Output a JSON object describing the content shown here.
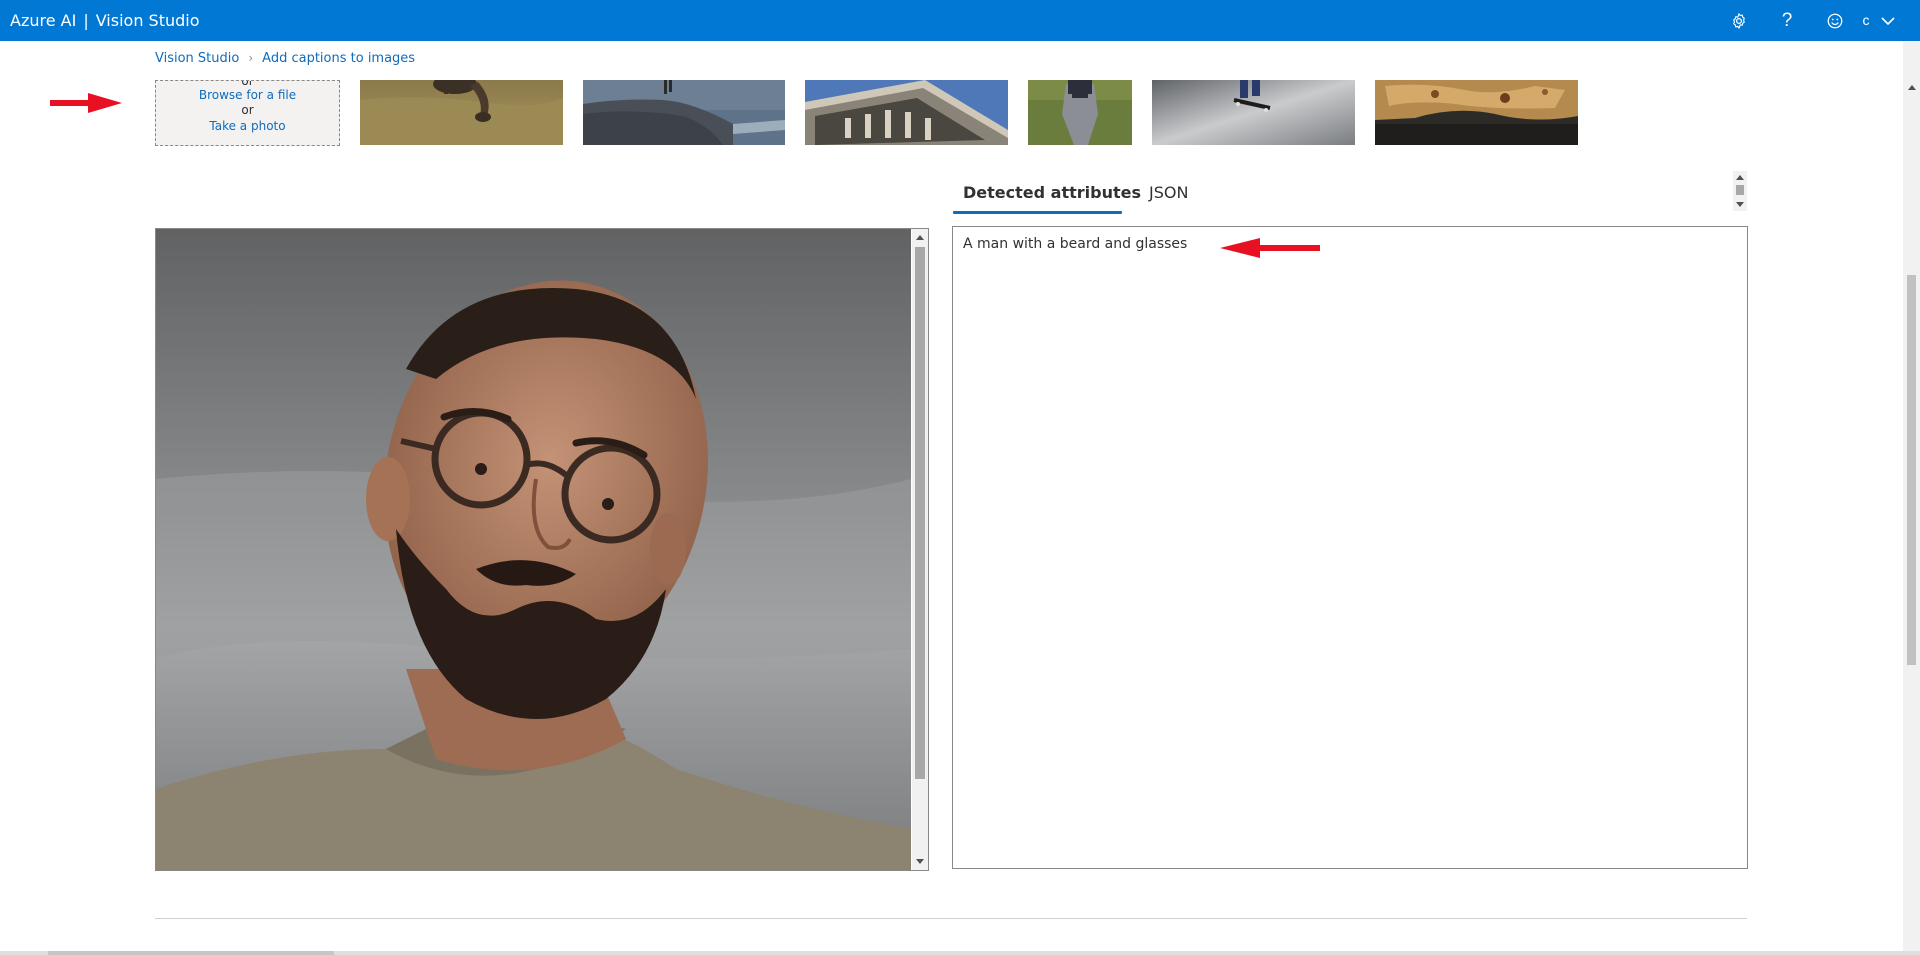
{
  "topbar": {
    "brand_left": "Azure AI",
    "brand_sep": "|",
    "brand_right": "Vision Studio",
    "user_initial": "c",
    "icons": [
      "gear-icon",
      "help-icon",
      "smiley-icon",
      "chevron-down-icon"
    ]
  },
  "breadcrumb": {
    "root": "Vision Studio",
    "current": "Add captions to images"
  },
  "upload": {
    "browse": "Browse for a file",
    "or": "or",
    "photo": "Take a photo"
  },
  "samples": [
    "sample-cow-grazing",
    "sample-person-on-rock",
    "sample-building-facade",
    "sample-baseball-player",
    "sample-skateboarder",
    "sample-food-plate"
  ],
  "tabs": {
    "detected": "Detected attributes",
    "json": "JSON"
  },
  "result": {
    "caption": "A man with a beard and glasses"
  },
  "colors": {
    "accent": "#0078d4",
    "link": "#0f6cbd",
    "annotation_arrow": "#e81123"
  }
}
